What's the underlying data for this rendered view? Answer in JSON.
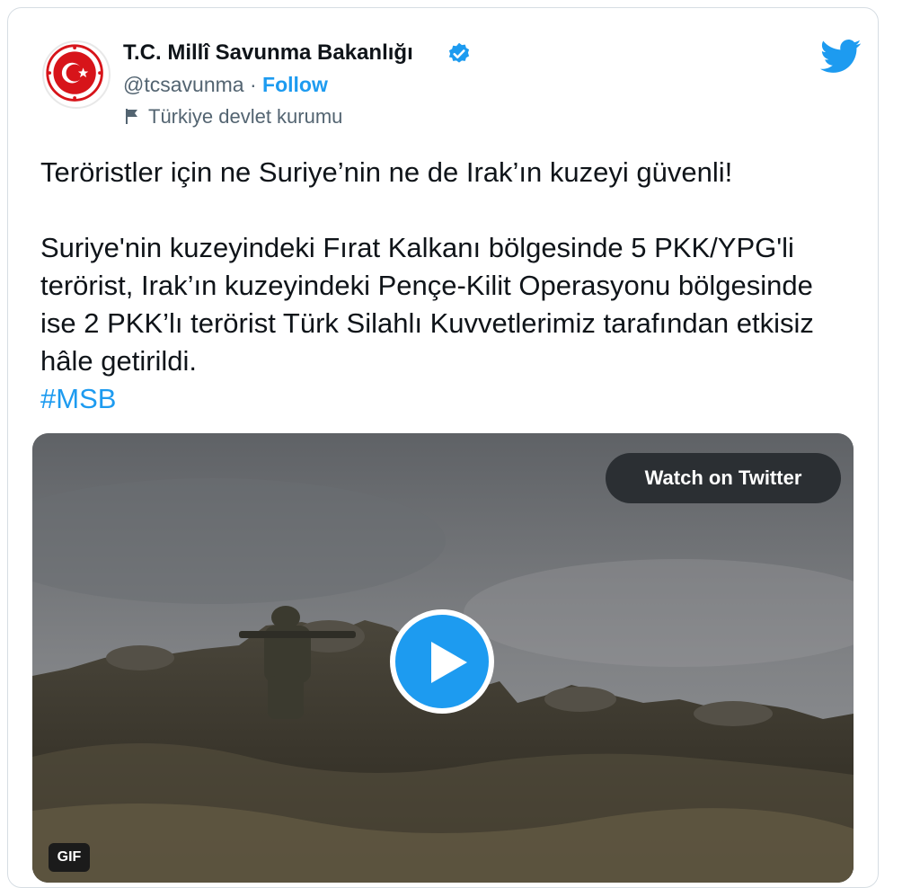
{
  "tweet": {
    "author_name": "T.C. Millî Savunma Bakanlığı",
    "handle": "@tcsavunma",
    "separator": " · ",
    "follow_label": "Follow",
    "account_label": "Türkiye devlet kurumu",
    "text_line1": "Teröristler için ne Suriye’nin ne de Irak’ın kuzeyi güvenli!",
    "text_line2": "Suriye'nin kuzeyindeki Fırat Kalkanı bölgesinde 5 PKK/YPG'li terörist, Irak’ın kuzeyindeki Pençe-Kilit Operasyonu bölgesinde ise 2 PKK’lı terörist Türk Silahlı Kuvvetlerimiz tarafından etkisiz hâle getirildi.",
    "hashtag": "#MSB"
  },
  "media": {
    "watch_label": "Watch on Twitter",
    "badge": "GIF"
  },
  "colors": {
    "accent": "#1d9bf0",
    "text": "#0f1419",
    "muted": "#536471",
    "emblem_red": "#d7141a"
  },
  "icons": [
    "avatar-emblem",
    "verified-badge-icon",
    "flag-icon",
    "twitter-bird-icon",
    "play-icon"
  ]
}
